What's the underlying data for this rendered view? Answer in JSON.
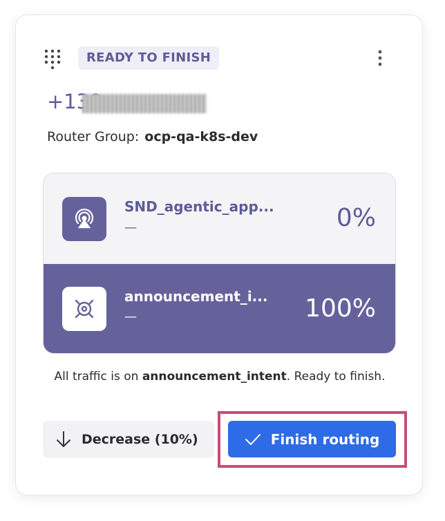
{
  "badge": {
    "label": "READY TO FINISH"
  },
  "phone": {
    "visible_prefix": "+130"
  },
  "router": {
    "label": "Router Group:",
    "value": "ocp-qa-k8s-dev"
  },
  "routes": [
    {
      "name": "SND_agentic_app...",
      "sub": "—",
      "percent": "0%",
      "icon": "signal-broadcast-icon"
    },
    {
      "name": "announcement_i...",
      "sub": "—",
      "percent": "100%",
      "icon": "target-crosshair-icon"
    }
  ],
  "status": {
    "prefix": "All traffic is on ",
    "target": "announcement_intent",
    "suffix": ". Ready to finish."
  },
  "actions": {
    "decrease_label": "Decrease (10%)",
    "finish_label": "Finish routing"
  },
  "colors": {
    "accent": "#65629b",
    "primary": "#2e6be6",
    "highlight": "#cb4a7b"
  }
}
